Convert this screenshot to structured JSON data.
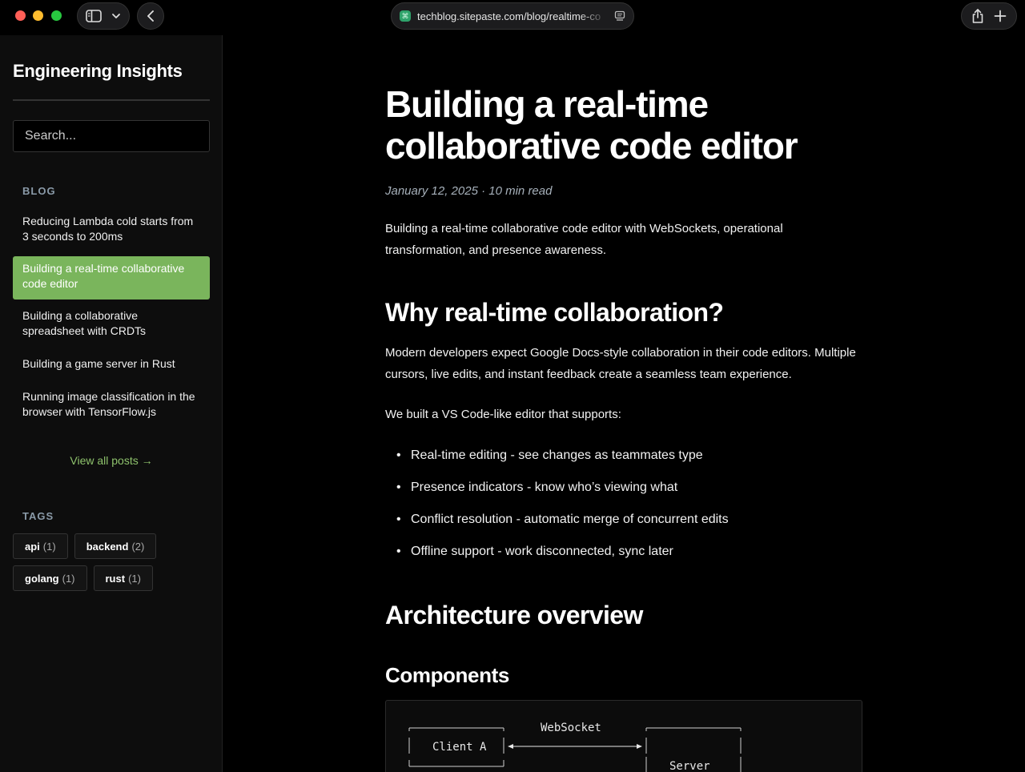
{
  "browser": {
    "url": "techblog.sitepaste.com/blog/realtime-co"
  },
  "sidebar": {
    "site_title": "Engineering Insights",
    "search_placeholder": "Search...",
    "blog_heading": "BLOG",
    "posts": [
      {
        "label": "Reducing Lambda cold starts from 3 seconds to 200ms",
        "active": false
      },
      {
        "label": "Building a real-time collaborative code editor",
        "active": true
      },
      {
        "label": "Building a collaborative spreadsheet with CRDTs",
        "active": false
      },
      {
        "label": "Building a game server in Rust",
        "active": false
      },
      {
        "label": "Running image classification in the browser with TensorFlow.js",
        "active": false
      }
    ],
    "view_all": "View all posts →",
    "tags_heading": "TAGS",
    "tags": [
      {
        "name": "api",
        "count": "(1)"
      },
      {
        "name": "backend",
        "count": "(2)"
      },
      {
        "name": "golang",
        "count": "(1)"
      },
      {
        "name": "rust",
        "count": "(1)"
      }
    ]
  },
  "article": {
    "title": "Building a real-time collaborative code editor",
    "meta": "January 12, 2025 · 10 min read",
    "intro": "Building a real-time collaborative code editor with WebSockets, operational transformation, and presence awareness.",
    "h2_why": "Why real-time collaboration?",
    "p_why": "Modern developers expect Google Docs-style collaboration in their code editors. Multiple cursors, live edits, and instant feedback create a seamless team experience.",
    "p_built": "We built a VS Code-like editor that supports:",
    "features": [
      "Real-time editing - see changes as teammates type",
      "Presence indicators - know who’s viewing what",
      "Conflict resolution - automatic merge of concurrent edits",
      "Offline support - work disconnected, sync later"
    ],
    "h2_arch": "Architecture overview",
    "h3_components": "Components",
    "diagram": {
      "client_label": "Client A",
      "link_label": "WebSocket",
      "server_label": "Server"
    }
  },
  "colors": {
    "accent": "#7ab55c",
    "link": "#8ec26c",
    "background": "#000000"
  }
}
